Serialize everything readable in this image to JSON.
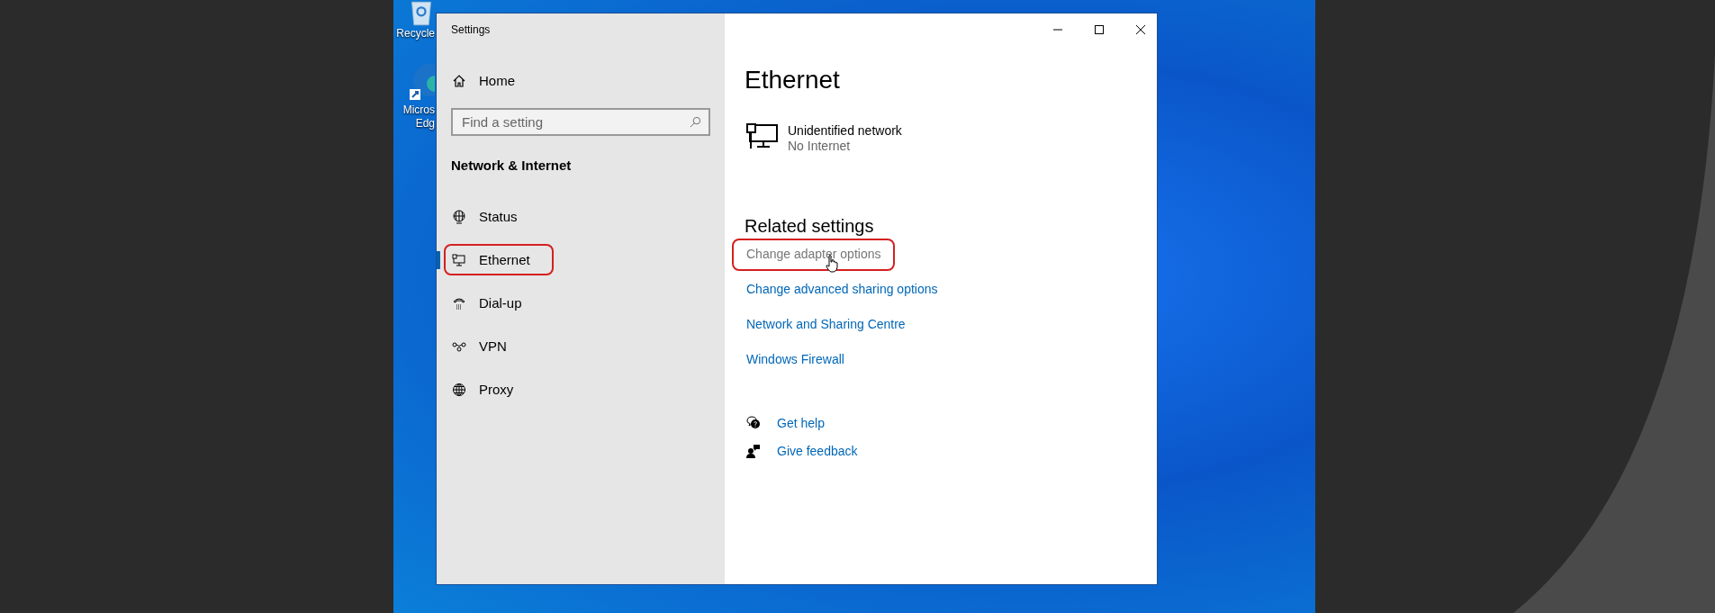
{
  "desktop_icons": [
    {
      "labels": [
        "Recycle"
      ],
      "kind": "recycle"
    },
    {
      "labels": [
        "Micros",
        "Edg"
      ],
      "kind": "browser"
    }
  ],
  "window": {
    "title": "Settings"
  },
  "sidebar": {
    "home": "Home",
    "search": {
      "placeholder": "Find a setting"
    },
    "section": "Network & Internet",
    "items": [
      {
        "label": "Status",
        "kind": "status",
        "selected": false,
        "highlighted": false
      },
      {
        "label": "Ethernet",
        "kind": "ethernet",
        "selected": true,
        "highlighted": true
      },
      {
        "label": "Dial-up",
        "kind": "dialup",
        "selected": false,
        "highlighted": false
      },
      {
        "label": "VPN",
        "kind": "vpn",
        "selected": false,
        "highlighted": false
      },
      {
        "label": "Proxy",
        "kind": "proxy",
        "selected": false,
        "highlighted": false
      }
    ]
  },
  "main": {
    "heading": "Ethernet",
    "network": {
      "name": "Unidentified network",
      "status": "No Internet"
    },
    "related_title": "Related settings",
    "related_links": [
      {
        "label": "Change adapter options",
        "hovered": true,
        "highlighted": true
      },
      {
        "label": "Change advanced sharing options",
        "hovered": false,
        "highlighted": false
      },
      {
        "label": "Network and Sharing Centre",
        "hovered": false,
        "highlighted": false
      },
      {
        "label": "Windows Firewall",
        "hovered": false,
        "highlighted": false
      }
    ],
    "help_links": [
      {
        "label": "Get help",
        "kind": "help"
      },
      {
        "label": "Give feedback",
        "kind": "feedback"
      }
    ]
  }
}
